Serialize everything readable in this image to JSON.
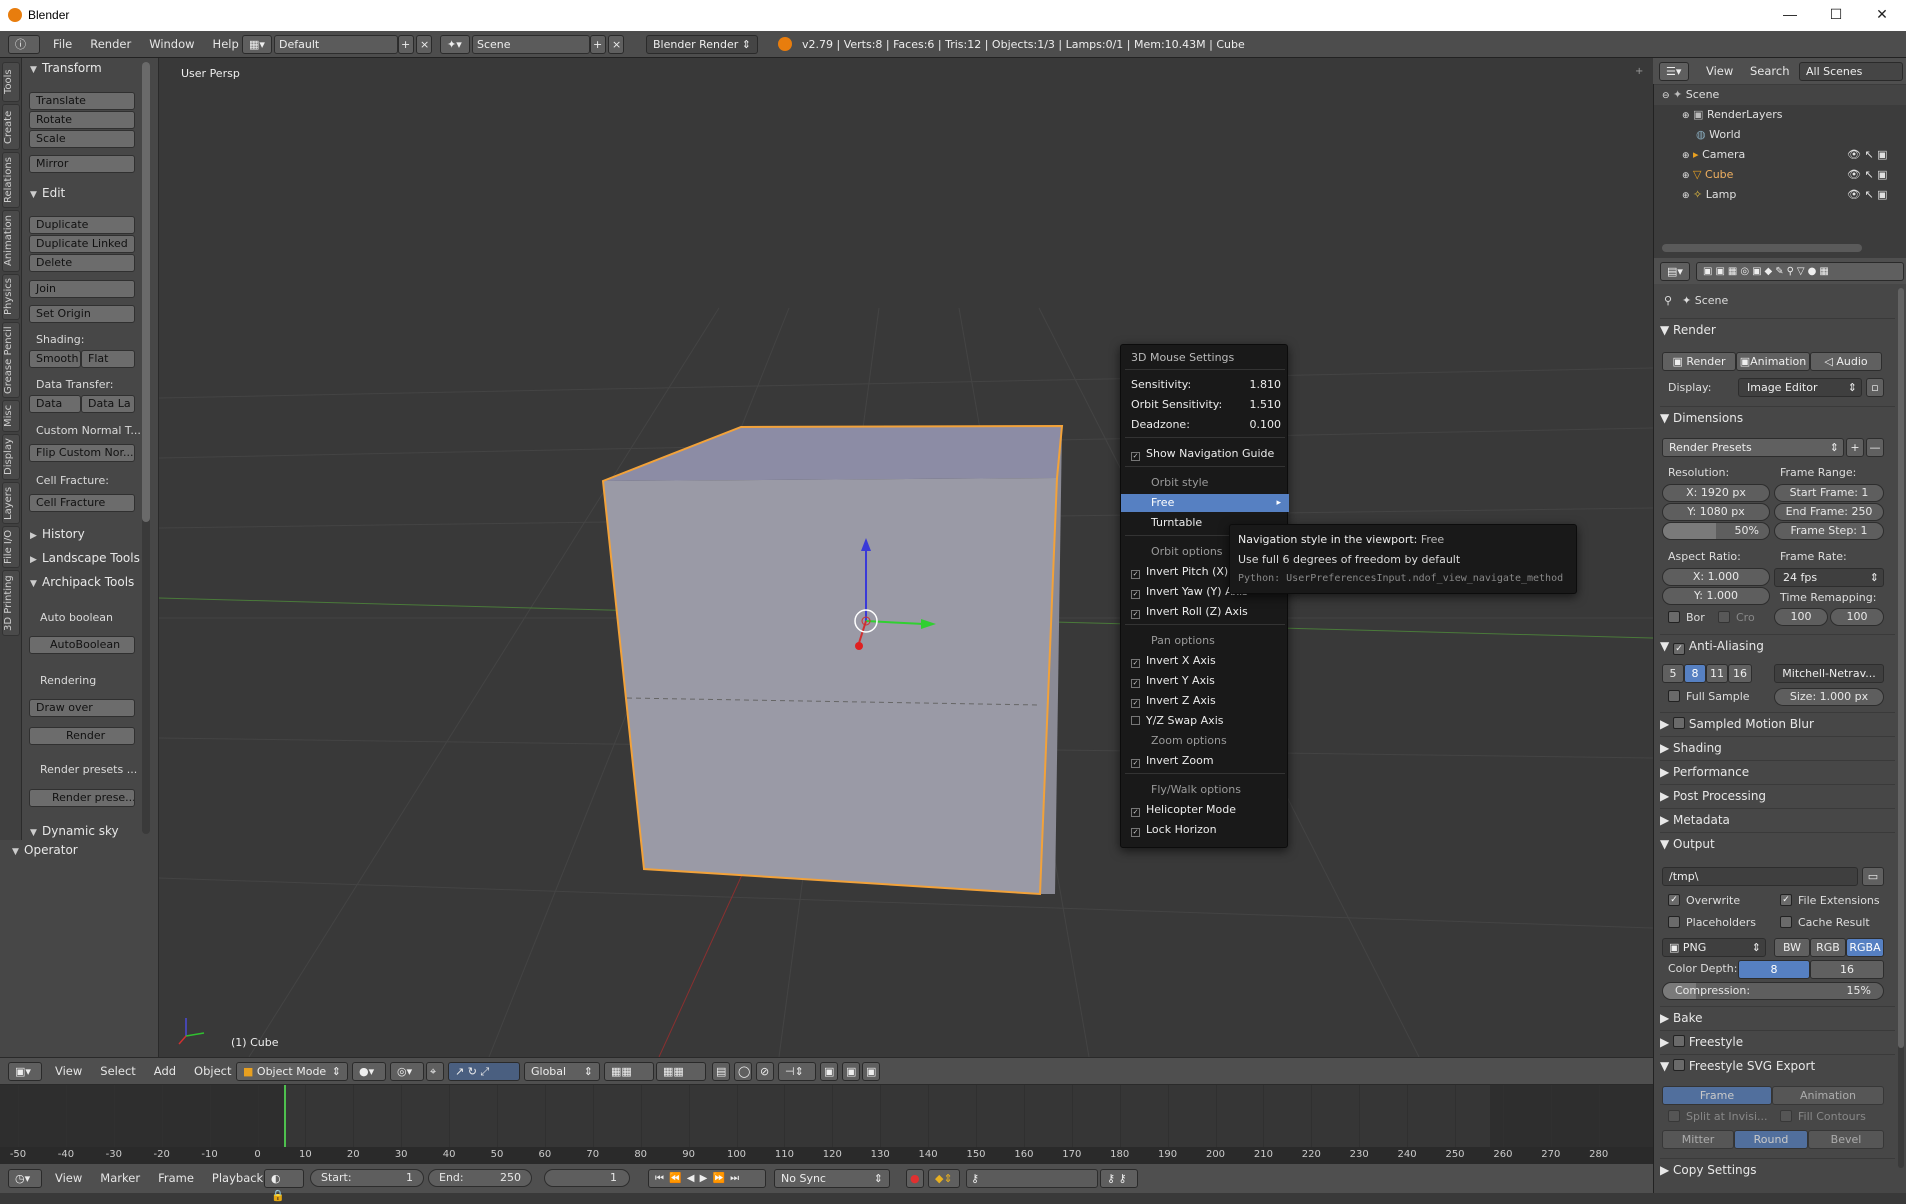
{
  "titlebar": {
    "title": "Blender",
    "min": "—",
    "max": "☐",
    "close": "✕"
  },
  "info": {
    "menus": [
      "File",
      "Render",
      "Window",
      "Help"
    ],
    "layout": "Default",
    "scene": "Scene",
    "engine": "Blender Render",
    "stats": "v2.79 | Verts:8 | Faces:6 | Tris:12 | Objects:1/3 | Lamps:0/1 | Mem:10.43M | Cube"
  },
  "tabs": [
    "Tools",
    "Create",
    "Relations",
    "Animation",
    "Physics",
    "Grease Pencil",
    "Misc",
    "Display",
    "Layers",
    "File I/O",
    "3D Printing"
  ],
  "tools": {
    "transform": "Transform",
    "translate": "Translate",
    "rotate": "Rotate",
    "scale": "Scale",
    "mirror": "Mirror",
    "edit": "Edit",
    "duplicate": "Duplicate",
    "duplicate_linked": "Duplicate Linked",
    "delete": "Delete",
    "join": "Join",
    "set_origin": "Set Origin",
    "shading": "Shading:",
    "smooth": "Smooth",
    "flat": "Flat",
    "data_transfer": "Data Transfer:",
    "data": "Data",
    "data_la": "Data La",
    "custom_normal": "Custom Normal T...",
    "flip_custom": "Flip Custom Nor...",
    "cell_fracture_label": "Cell Fracture:",
    "cell_fracture": "Cell Fracture",
    "history": "History",
    "landscape": "Landscape Tools",
    "archipack": "Archipack Tools",
    "auto_boolean_label": "Auto boolean",
    "auto_boolean": "AutoBoolean",
    "rendering_label": "Rendering",
    "draw_over": "Draw over",
    "render": "Render",
    "render_presets_label": "Render presets ...",
    "render_presets": "Render prese...",
    "dynamic_sky": "Dynamic sky",
    "operator": "Operator"
  },
  "viewport": {
    "view_label": "User Persp",
    "object_label": "(1) Cube"
  },
  "vpheader": {
    "menus": [
      "View",
      "Select",
      "Add",
      "Object"
    ],
    "mode": "Object Mode",
    "orientation": "Global"
  },
  "popup": {
    "title": "3D Mouse Settings",
    "sensitivity_label": "Sensitivity:",
    "sensitivity": "1.810",
    "orbit_sens_label": "Orbit Sensitivity:",
    "orbit_sens": "1.510",
    "deadzone_label": "Deadzone:",
    "deadzone": "0.100",
    "nav_guide": "Show Navigation Guide",
    "orbit_style": "Orbit style",
    "free": "Free",
    "turntable": "Turntable",
    "orbit_options": "Orbit options",
    "inv_pitch": "Invert Pitch (X) Axis",
    "inv_yaw": "Invert Yaw (Y) Axis",
    "inv_roll": "Invert Roll (Z) Axis",
    "pan_options": "Pan options",
    "inv_x": "Invert X Axis",
    "inv_y": "Invert Y Axis",
    "inv_z": "Invert Z Axis",
    "yz_swap": "Y/Z Swap Axis",
    "zoom_options": "Zoom options",
    "inv_zoom": "Invert Zoom",
    "fly_options": "Fly/Walk options",
    "heli": "Helicopter Mode",
    "lock_horizon": "Lock Horizon"
  },
  "tooltip": {
    "label": "Navigation style in the viewport:",
    "value": "Free",
    "desc": "Use full 6 degrees of freedom by default",
    "python": "Python: UserPreferencesInput.ndof_view_navigate_method"
  },
  "outliner": {
    "menus": [
      "View",
      "Search"
    ],
    "filter": "All Scenes",
    "items": [
      "Scene",
      "RenderLayers",
      "World",
      "Camera",
      "Cube",
      "Lamp"
    ]
  },
  "props": {
    "context": "Scene",
    "render": "Render",
    "render_btn": "Render",
    "animation_btn": "Animation",
    "audio_btn": "Audio",
    "display_label": "Display:",
    "display": "Image Editor",
    "dimensions": "Dimensions",
    "presets": "Render Presets",
    "resolution": "Resolution:",
    "res_x": "X:   1920 px",
    "res_y": "Y:   1080 px",
    "res_pct": "50%",
    "frame_range": "Frame Range:",
    "start": "Start Frame:  1",
    "end": "End Frame: 250",
    "step": "Frame Step:  1",
    "aspect": "Aspect Ratio:",
    "asp_x": "X:      1.000",
    "asp_y": "Y:      1.000",
    "frame_rate": "Frame Rate:",
    "fps": "24 fps",
    "time_remap": "Time Remapping:",
    "remap_old": "100",
    "remap_new": "100",
    "bor": "Bor",
    "cro": "Cro",
    "anti_aliasing": "Anti-Aliasing",
    "aa": [
      "5",
      "8",
      "11",
      "16"
    ],
    "filter": "Mitchell-Netrav...",
    "full_sample": "Full Sample",
    "size": "Size: 1.000 px",
    "motion_blur": "Sampled Motion Blur",
    "shading": "Shading",
    "performance": "Performance",
    "post": "Post Processing",
    "metadata": "Metadata",
    "output": "Output",
    "path": "/tmp\\",
    "overwrite": "Overwrite",
    "file_ext": "File Extensions",
    "placeholders": "Placeholders",
    "cache": "Cache Result",
    "format": "PNG",
    "bw": "BW",
    "rgb": "RGB",
    "rgba": "RGBA",
    "color_depth": "Color Depth:",
    "d8": "8",
    "d16": "16",
    "compression": "Compression:",
    "comp_val": "15%",
    "bake": "Bake",
    "freestyle": "Freestyle",
    "fs_svg": "Freestyle SVG Export",
    "frame": "Frame",
    "animation": "Animation",
    "split": "Split at Invisi...",
    "fill": "Fill Contours",
    "mitter": "Mitter",
    "round": "Round",
    "bevel": "Bevel",
    "copy": "Copy Settings"
  },
  "timeline": {
    "ticks": [
      "-50",
      "-40",
      "-30",
      "-20",
      "-10",
      "0",
      "10",
      "20",
      "30",
      "40",
      "50",
      "60",
      "70",
      "80",
      "90",
      "100",
      "110",
      "120",
      "130",
      "140",
      "150",
      "160",
      "170",
      "180",
      "190",
      "200",
      "210",
      "220",
      "230",
      "240",
      "250",
      "260",
      "270",
      "280"
    ],
    "menus": [
      "View",
      "Marker",
      "Frame",
      "Playback"
    ],
    "start": "Start:",
    "start_val": "1",
    "end": "End:",
    "end_val": "250",
    "current": "1",
    "sync": "No Sync"
  }
}
